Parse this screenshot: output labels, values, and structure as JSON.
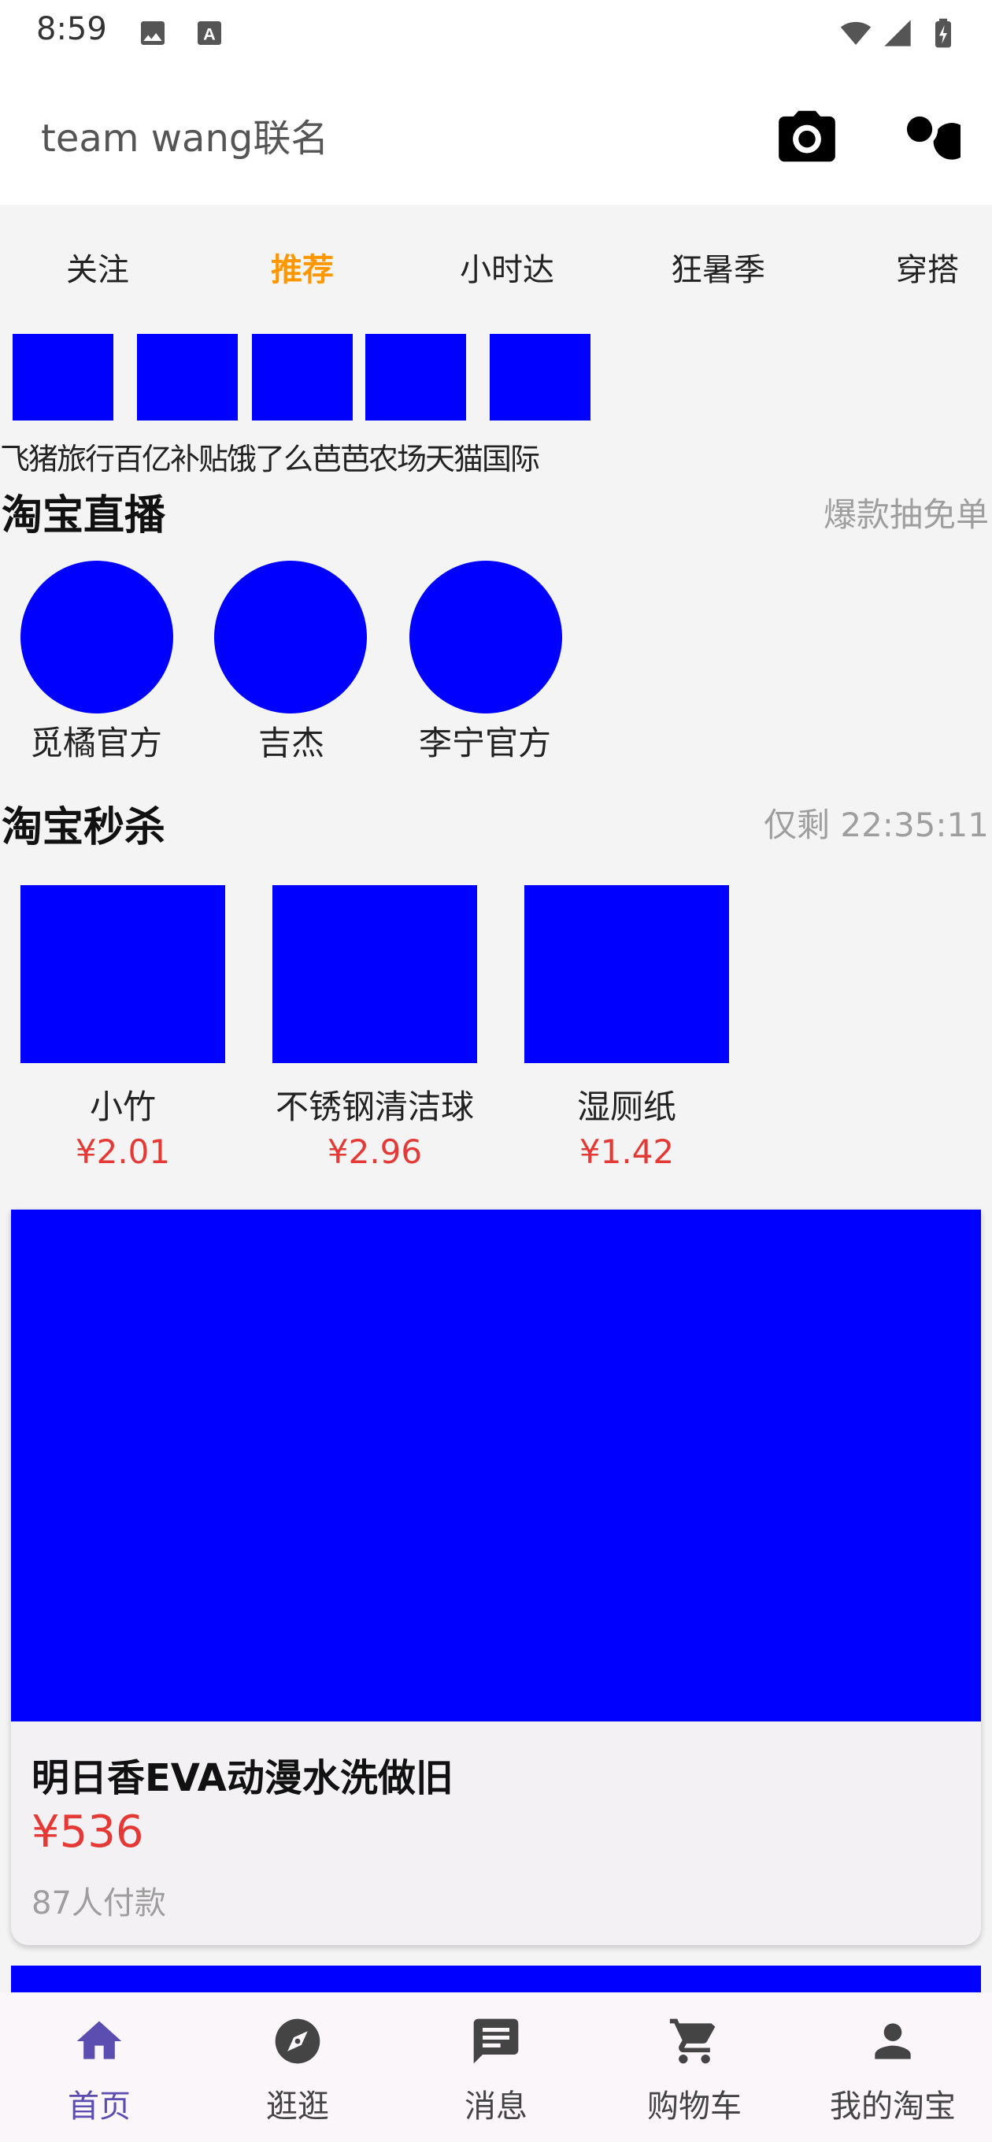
{
  "status_bar": {
    "time": "8:59",
    "icons": [
      "image-icon",
      "a-badge-icon",
      "wifi-icon",
      "signal-icon",
      "battery-charging-icon"
    ]
  },
  "search": {
    "text": "team wang联名",
    "camera_icon": "camera-icon",
    "search_icon": "search-icon"
  },
  "tabs": [
    {
      "label": "关注",
      "active": false
    },
    {
      "label": "推荐",
      "active": true
    },
    {
      "label": "小时达",
      "active": false
    },
    {
      "label": "狂暑季",
      "active": false
    },
    {
      "label": "穿搭",
      "active": false
    }
  ],
  "quick_entries": {
    "labels_line": "飞猪旅行百亿补贴饿了么芭芭农场天猫国际",
    "items": [
      "飞猪旅行",
      "百亿补贴",
      "饿了么",
      "芭芭农场",
      "天猫国际"
    ]
  },
  "live": {
    "title": "淘宝直播",
    "extra": "爆款抽免单",
    "items": [
      {
        "label": "觅橘官方"
      },
      {
        "label": "吉杰"
      },
      {
        "label": "李宁官方"
      }
    ]
  },
  "flash_sale": {
    "title": "淘宝秒杀",
    "countdown": "仅剩 22:35:11",
    "items": [
      {
        "name": "小竹",
        "price": "¥2.01"
      },
      {
        "name": "不锈钢清洁球",
        "price": "¥2.96"
      },
      {
        "name": "湿厕纸",
        "price": "¥1.42"
      }
    ]
  },
  "product": {
    "title": "明日香EVA动漫水洗做旧",
    "price": "¥536",
    "sold": "87人付款"
  },
  "bottom_nav": [
    {
      "label": "首页",
      "icon": "home-icon",
      "active": true
    },
    {
      "label": "逛逛",
      "icon": "compass-icon",
      "active": false
    },
    {
      "label": "消息",
      "icon": "message-icon",
      "active": false
    },
    {
      "label": "购物车",
      "icon": "cart-icon",
      "active": false
    },
    {
      "label": "我的淘宝",
      "icon": "person-icon",
      "active": false
    }
  ],
  "colors": {
    "accent_tab": "#ff9800",
    "price": "#e53935",
    "placeholder_blue": "#0000ff",
    "nav_active": "#5c4db1"
  }
}
